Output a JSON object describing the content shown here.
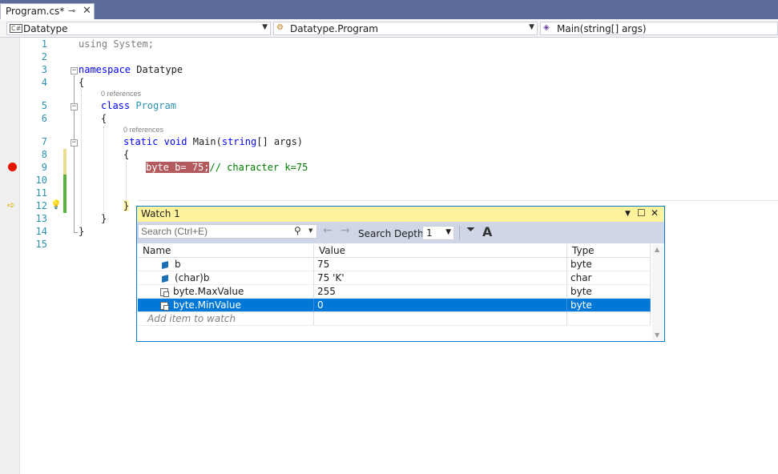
{
  "document_tab": {
    "title": "Program.cs*",
    "pin_icon": "pin-icon",
    "close_icon": "close-icon"
  },
  "navbar": {
    "project": "Datatype",
    "type": "Datatype.Program",
    "member": "Main(string[] args)"
  },
  "editor": {
    "line_numbers": [
      "1",
      "2",
      "3",
      "4",
      "5",
      "6",
      "7",
      "8",
      "9",
      "10",
      "11",
      "12",
      "13",
      "14",
      "15"
    ],
    "codelens_class": "0 references",
    "codelens_main": "0 references",
    "code": {
      "l1_kw": "using",
      "l1_rest": " System;",
      "l3_kw": "namespace",
      "l3_rest": " Datatype",
      "l4": "{",
      "l5_kw": "class",
      "l5_type": "Program",
      "l6": "{",
      "l7_kw1": "static",
      "l7_kw2": "void",
      "l7_name": "Main(",
      "l7_kw3": "string",
      "l7_rest": "[] args)",
      "l8": "{",
      "l9_stmt": "byte b= 75;",
      "l9_comment": "// character k=75",
      "l12": "}",
      "l13": "}",
      "l14": "}"
    }
  },
  "watch": {
    "title": "Watch 1",
    "search_placeholder": "Search (Ctrl+E)",
    "search_depth_label": "Search Depth:",
    "search_depth_value": "1",
    "columns": {
      "name": "Name",
      "value": "Value",
      "type": "Type"
    },
    "rows": [
      {
        "name": "b",
        "value": "75",
        "type": "byte"
      },
      {
        "name": "(char)b",
        "value": "75 'K'",
        "type": "char"
      },
      {
        "name": "byte.MaxValue",
        "value": "255",
        "type": "byte"
      },
      {
        "name": "byte.MinValue",
        "value": "0",
        "type": "byte"
      }
    ],
    "add_item_placeholder": "Add item to watch",
    "selected_row": 3
  },
  "colors": {
    "tab_strip": "#5d6b99",
    "watch_title": "#fff29d",
    "selection": "#0078d7",
    "breakpoint": "#e51400",
    "highlight": "#b35a5e"
  }
}
